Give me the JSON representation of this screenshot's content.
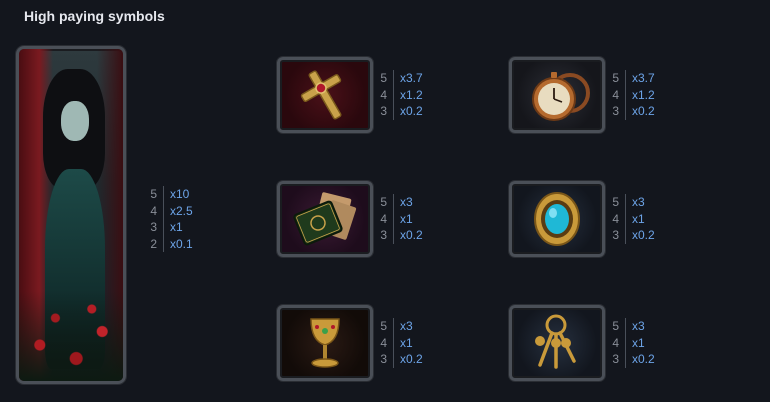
{
  "title": "High paying symbols",
  "wild": {
    "icon": "gothic-lady-icon",
    "pays": [
      {
        "count": "5",
        "mult": "x10"
      },
      {
        "count": "4",
        "mult": "x2.5"
      },
      {
        "count": "3",
        "mult": "x1"
      },
      {
        "count": "2",
        "mult": "x0.1"
      }
    ]
  },
  "symbols": [
    {
      "icon": "cross-icon",
      "pays": [
        {
          "count": "5",
          "mult": "x3.7"
        },
        {
          "count": "4",
          "mult": "x1.2"
        },
        {
          "count": "3",
          "mult": "x0.2"
        }
      ]
    },
    {
      "icon": "pocket-watch-icon",
      "pays": [
        {
          "count": "5",
          "mult": "x3.7"
        },
        {
          "count": "4",
          "mult": "x1.2"
        },
        {
          "count": "3",
          "mult": "x0.2"
        }
      ]
    },
    {
      "icon": "spell-book-icon",
      "pays": [
        {
          "count": "5",
          "mult": "x3"
        },
        {
          "count": "4",
          "mult": "x1"
        },
        {
          "count": "3",
          "mult": "x0.2"
        }
      ]
    },
    {
      "icon": "brooch-icon",
      "pays": [
        {
          "count": "5",
          "mult": "x3"
        },
        {
          "count": "4",
          "mult": "x1"
        },
        {
          "count": "3",
          "mult": "x0.2"
        }
      ]
    },
    {
      "icon": "goblet-icon",
      "pays": [
        {
          "count": "5",
          "mult": "x3"
        },
        {
          "count": "4",
          "mult": "x1"
        },
        {
          "count": "3",
          "mult": "x0.2"
        }
      ]
    },
    {
      "icon": "keys-icon",
      "pays": [
        {
          "count": "5",
          "mult": "x3"
        },
        {
          "count": "4",
          "mult": "x1"
        },
        {
          "count": "3",
          "mult": "x0.2"
        }
      ]
    }
  ]
}
